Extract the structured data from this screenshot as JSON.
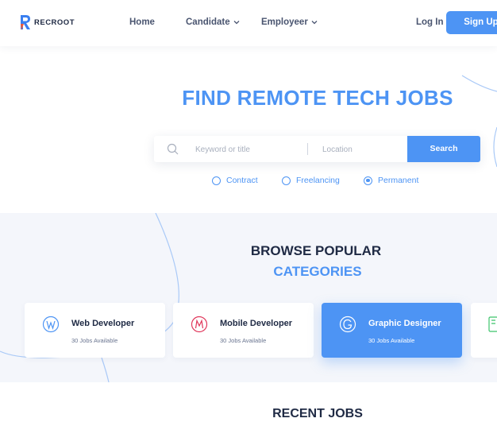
{
  "brand": {
    "name": "RECROOT"
  },
  "nav": {
    "home": "Home",
    "candidate": "Candidate",
    "employer": "Employeer",
    "login": "Log In",
    "signup": "Sign Up"
  },
  "hero": {
    "title": "FIND REMOTE TECH JOBS",
    "keyword_placeholder": "Keyword or title",
    "location_placeholder": "Location",
    "search_label": "Search",
    "job_types": [
      {
        "label": "Contract",
        "selected": false
      },
      {
        "label": "Freelancing",
        "selected": false
      },
      {
        "label": "Permanent",
        "selected": true
      }
    ]
  },
  "categories": {
    "title_line1": "BROWSE POPULAR",
    "title_line2": "CATEGORIES",
    "items": [
      {
        "title": "Web Developer",
        "count": "30 Jobs Available",
        "icon": "web-developer-icon",
        "icon_color": "#4d94f4"
      },
      {
        "title": "Mobile Developer",
        "count": "30 Jobs Available",
        "icon": "mobile-developer-icon",
        "icon_color": "#e0365a"
      },
      {
        "title": "Graphic Designer",
        "count": "30 Jobs Available",
        "icon": "graphic-designer-icon",
        "icon_color": "#ffffff",
        "active": true
      },
      {
        "title": "",
        "count": "",
        "icon": "category-icon",
        "icon_color": "#3cc46b"
      }
    ]
  },
  "recent": {
    "title": "RECENT JOBS"
  },
  "colors": {
    "accent": "#4d94f4",
    "dark": "#1f2a44",
    "section_bg": "#f4f6fb"
  }
}
